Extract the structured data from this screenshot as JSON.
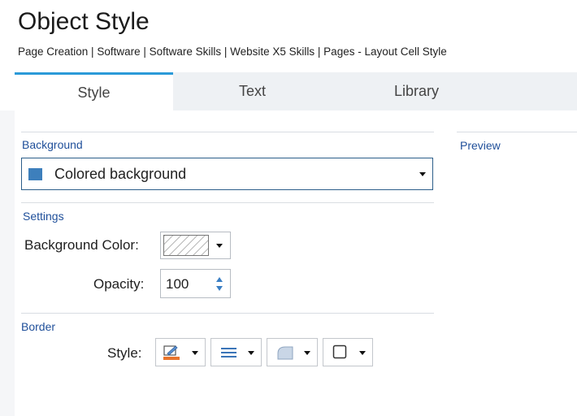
{
  "window": {
    "title": "Object Style",
    "breadcrumb": "Page Creation | Software | Software Skills | Website X5 Skills | Pages - Layout Cell Style"
  },
  "tabs": [
    {
      "label": "Style",
      "active": true
    },
    {
      "label": "Text",
      "active": false
    },
    {
      "label": "Library",
      "active": false
    }
  ],
  "background": {
    "section_label": "Background",
    "select_value": "Colored background",
    "swatch_color": "#3d7fbc",
    "icon": "color-swatch-icon"
  },
  "settings": {
    "section_label": "Settings",
    "bg_color_label": "Background Color:",
    "bg_color_value": "transparent",
    "opacity_label": "Opacity:",
    "opacity_value": "100"
  },
  "border": {
    "section_label": "Border",
    "style_label": "Style:",
    "buttons": [
      "border-color-icon",
      "border-line-style-icon",
      "corner-radius-icon",
      "shadow-box-icon"
    ]
  },
  "preview": {
    "section_label": "Preview"
  },
  "colors": {
    "accent": "#2b9ad8",
    "section_label": "#1f4f9a",
    "spinner_arrow": "#3b7fc4"
  }
}
